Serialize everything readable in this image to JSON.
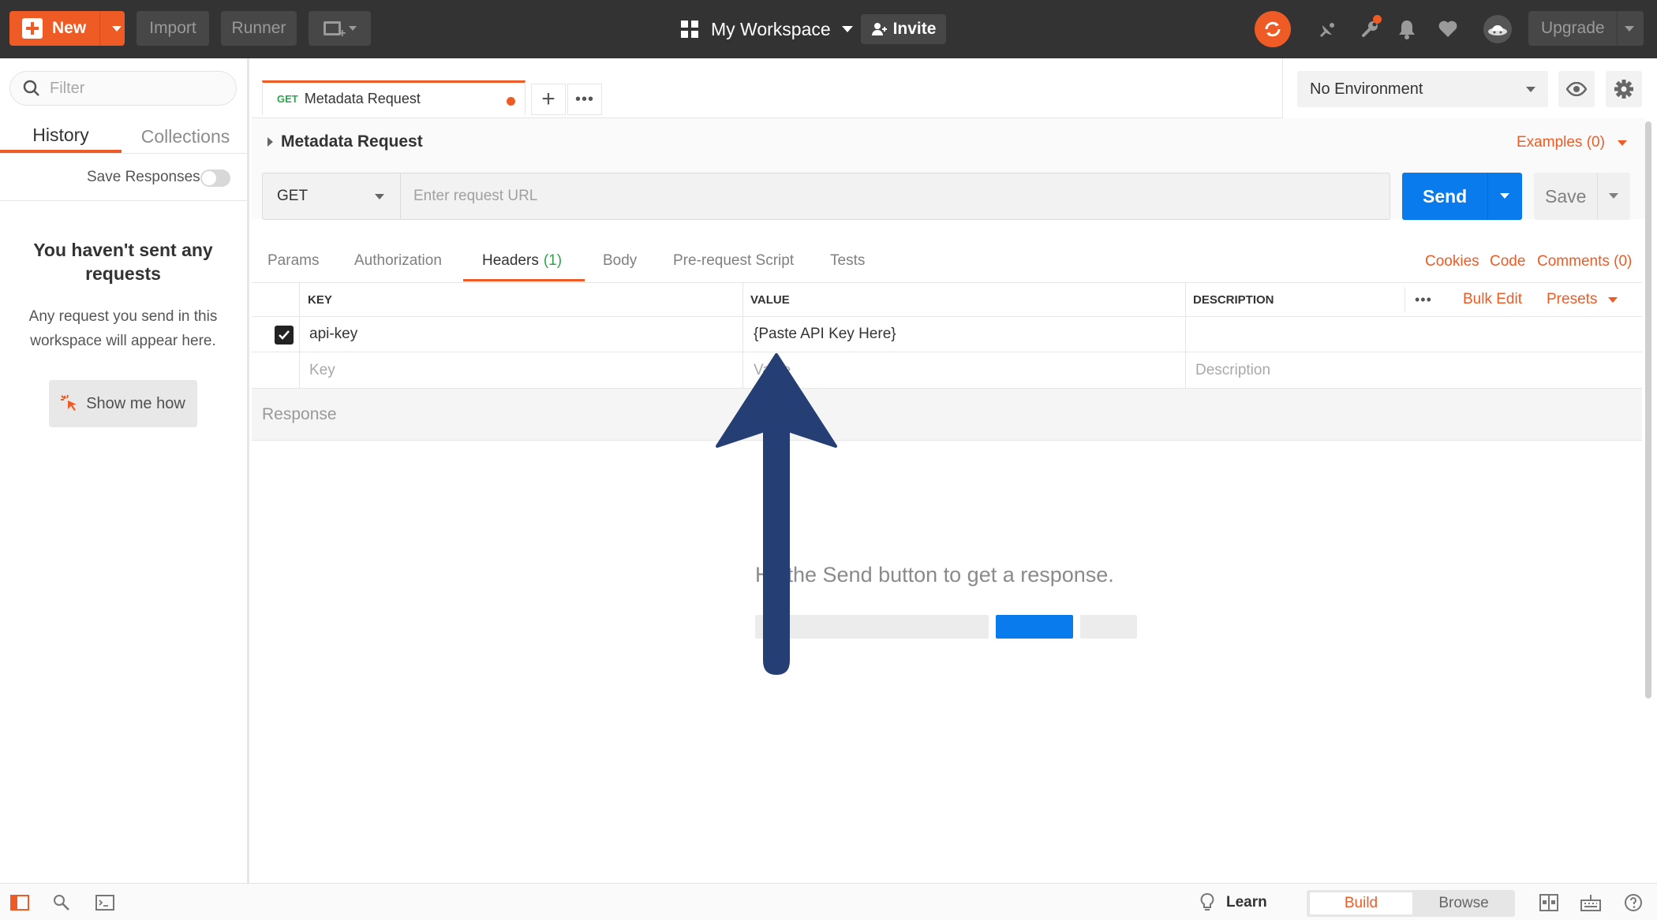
{
  "topbar": {
    "new_label": "New",
    "import_label": "Import",
    "runner_label": "Runner",
    "workspace_name": "My Workspace",
    "invite_label": "Invite",
    "upgrade_label": "Upgrade"
  },
  "sidebar": {
    "filter_placeholder": "Filter",
    "tabs": [
      {
        "label": "History",
        "active": true
      },
      {
        "label": "Collections",
        "active": false
      }
    ],
    "save_responses_label": "Save Responses",
    "save_responses_on": false,
    "empty_title": "You haven't sent any requests",
    "empty_desc": "Any request you send in this workspace will appear here.",
    "show_me_how_label": "Show me how"
  },
  "request_tab": {
    "method": "GET",
    "name": "Metadata Request",
    "unsaved": true
  },
  "environment": {
    "selected": "No Environment"
  },
  "request": {
    "title": "Metadata Request",
    "examples_label": "Examples (0)",
    "method": "GET",
    "url_placeholder": "Enter request URL",
    "url_value": "",
    "send_label": "Send",
    "save_label": "Save"
  },
  "subtabs": {
    "params": "Params",
    "authorization": "Authorization",
    "headers": "Headers",
    "headers_count": "(1)",
    "body": "Body",
    "prerequest": "Pre-request Script",
    "tests": "Tests",
    "active": "Headers"
  },
  "right_links": {
    "cookies": "Cookies",
    "code": "Code",
    "comments": "Comments (0)"
  },
  "headers_table": {
    "columns": {
      "key": "KEY",
      "value": "VALUE",
      "description": "DESCRIPTION"
    },
    "bulk_edit_label": "Bulk Edit",
    "presets_label": "Presets",
    "rows": [
      {
        "checked": true,
        "key": "api-key",
        "value": "{Paste API Key Here}",
        "description": ""
      }
    ],
    "new_row": {
      "key_placeholder": "Key",
      "value_placeholder": "Value",
      "description_placeholder": "Description"
    }
  },
  "response": {
    "label": "Response",
    "empty_message": "Hit the Send button to get a response."
  },
  "statusbar": {
    "learn_label": "Learn",
    "build_label": "Build",
    "browse_label": "Browse",
    "active_mode": "Build"
  },
  "colors": {
    "accent_orange": "#ef5b25",
    "send_blue": "#097bed",
    "topbar_bg": "#333333",
    "method_green": "#2ea44f",
    "annotation_arrow": "#253f74"
  },
  "icons": [
    "plus-icon",
    "caret-down-icon",
    "new-window-icon",
    "workspace-grid-icon",
    "add-user-icon",
    "sync-icon",
    "satellite-icon",
    "wrench-icon",
    "bell-icon",
    "heart-icon",
    "avatar-icon",
    "search-icon",
    "cursor-click-icon",
    "eye-icon",
    "gear-icon",
    "checkmark-icon",
    "sidebar-toggle-icon",
    "find-icon",
    "console-icon",
    "lightbulb-icon",
    "two-pane-icon",
    "keyboard-icon",
    "help-icon",
    "annotation-arrow"
  ]
}
